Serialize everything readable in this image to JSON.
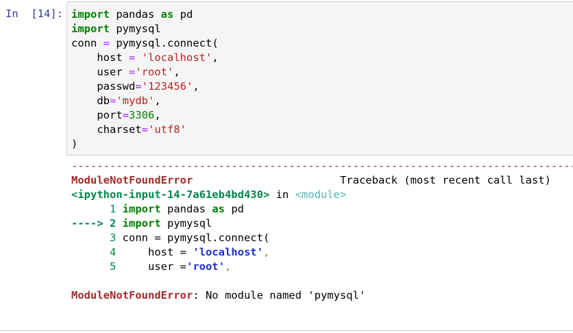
{
  "cell": {
    "prompt": "In  [14]:",
    "code": {
      "line1": {
        "kw1": "import",
        "mod": " pandas ",
        "kw2": "as",
        "alias": " pd"
      },
      "line2": {
        "kw1": "import",
        "mod": " pymysql"
      },
      "line3": {
        "a": "conn ",
        "eq": "=",
        "b": " pymysql.connect("
      },
      "line4": {
        "a": "    host ",
        "eq": "=",
        "sp": " ",
        "val": "'localhost'",
        "tail": ","
      },
      "line5": {
        "a": "    user ",
        "eq": "=",
        "val": "'root'",
        "tail": ","
      },
      "line6": {
        "a": "    passwd",
        "eq": "=",
        "val": "'123456'",
        "tail": ","
      },
      "line7": {
        "a": "    db",
        "eq": "=",
        "val": "'mydb'",
        "tail": ","
      },
      "line8": {
        "a": "    port",
        "eq": "=",
        "val": "3306",
        "tail": ","
      },
      "line9": {
        "a": "    charset",
        "eq": "=",
        "val": "'utf8'"
      },
      "line10": {
        "a": ")"
      }
    }
  },
  "output": {
    "separator": "--------------------------------------------------------------------------------",
    "error_name": "ModuleNotFoundError",
    "traceback_label": "Traceback (most recent call last)",
    "location": "<ipython-input-14-7a61eb4bd430>",
    "in_word": " in ",
    "module": "<module>",
    "tb1": {
      "lno": "      1 ",
      "kw1": "import",
      "mod": " pandas ",
      "kw2": "as",
      "alias": " pd"
    },
    "tb2": {
      "arrow": "----> 2 ",
      "kw1": "import",
      "mod": " pymysql"
    },
    "tb3": {
      "lno": "      3 ",
      "text": "conn = pymysql.connect("
    },
    "tb4": {
      "lno": "      4 ",
      "a": "    host = ",
      "val": "'localhost'",
      "tail": ","
    },
    "tb5": {
      "lno": "      5 ",
      "a": "    user =",
      "val": "'root'",
      "tail": ","
    },
    "final_error": "ModuleNotFoundError",
    "final_message": ": No module named 'pymysql'"
  }
}
